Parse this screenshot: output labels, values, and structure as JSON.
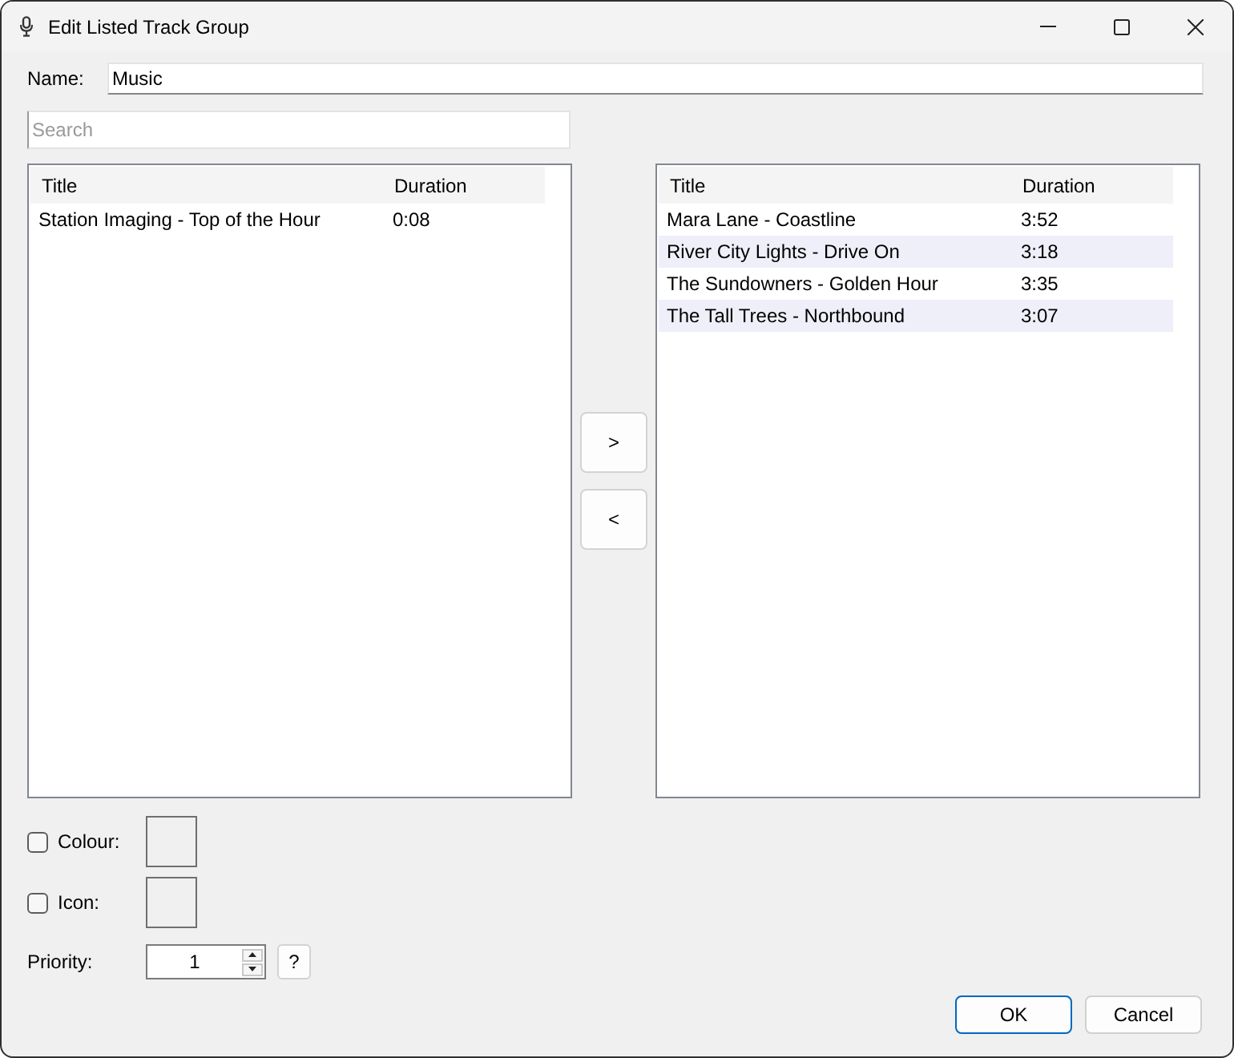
{
  "window": {
    "title": "Edit Listed Track Group"
  },
  "name_field": {
    "label": "Name:",
    "value": "Music"
  },
  "search": {
    "placeholder": "Search"
  },
  "available_tracks": {
    "columns": [
      "Title",
      "Duration"
    ],
    "rows": [
      {
        "title": "Station Imaging - Top of the Hour",
        "duration": "0:08"
      }
    ]
  },
  "move_buttons": [
    ">",
    "<"
  ],
  "group_tracks": {
    "columns": [
      "Title",
      "Duration"
    ],
    "rows": [
      {
        "title": "Mara Lane - Coastline",
        "duration": "3:52"
      },
      {
        "title": "River City Lights - Drive On",
        "duration": "3:18"
      },
      {
        "title": "The Sundowners - Golden Hour",
        "duration": "3:35"
      },
      {
        "title": "The Tall Trees - Northbound",
        "duration": "3:07"
      }
    ]
  },
  "options": [
    {
      "label": "Colour:",
      "checked": false
    },
    {
      "label": "Icon:",
      "checked": false
    }
  ],
  "priority": {
    "label": "Priority:",
    "value": "1",
    "help_button": "?"
  },
  "buttons": [
    {
      "label": "OK",
      "default": true
    },
    {
      "label": "Cancel",
      "default": false
    }
  ]
}
